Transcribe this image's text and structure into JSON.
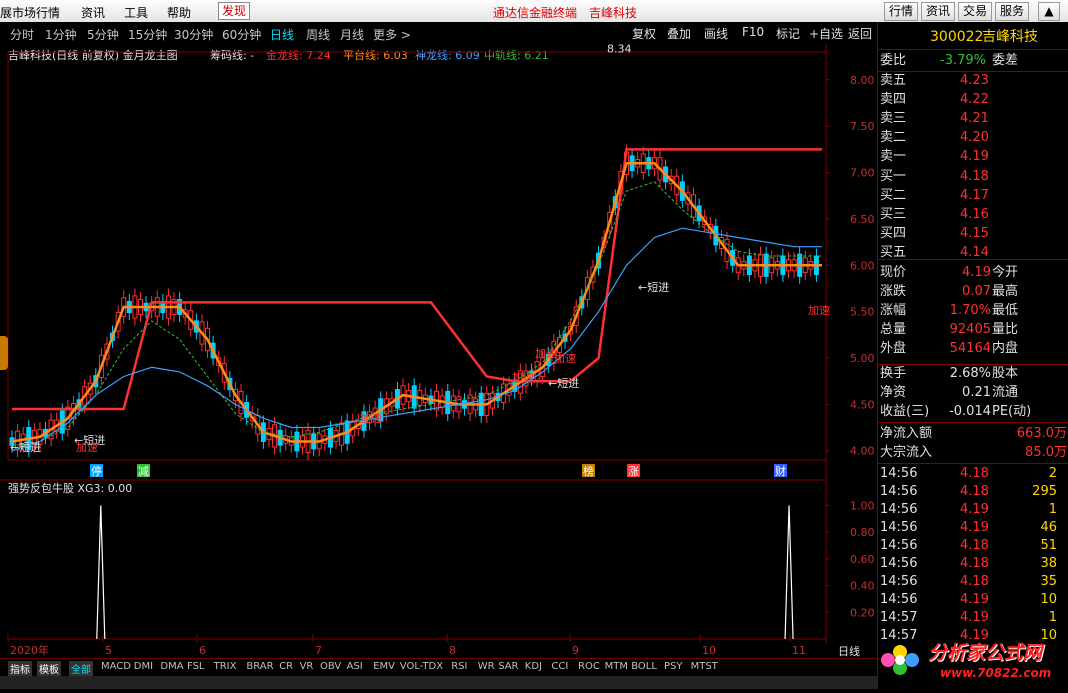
{
  "menubar": {
    "items": [
      "展市场行情",
      "资讯",
      "工具",
      "帮助"
    ],
    "discover": "发现",
    "notice": [
      "通达信金融终端",
      "吉峰科技"
    ],
    "right_buttons": [
      "行情",
      "资讯",
      "交易",
      "服务"
    ]
  },
  "toolbar": {
    "timeframes": [
      "分时",
      "1分钟",
      "5分钟",
      "15分钟",
      "30分钟",
      "60分钟",
      "日线",
      "周线",
      "月线",
      "更多 >"
    ],
    "active": "日线",
    "buttons": [
      "复权",
      "叠加",
      "画线",
      "F10",
      "标记",
      "+自选",
      "返回"
    ]
  },
  "info": {
    "title": "吉峰科技(日线 前复权) 金月龙主图",
    "chip": "筹码线: -",
    "jinlong": "金龙线: 7.24",
    "pingtai": "平台线: 6.03",
    "shenlong": "神龙线: 6.09",
    "zhonggui": "中轨线: 6.21"
  },
  "chart_data": [
    {
      "type": "line",
      "title": "",
      "x": [
        "2020年",
        "5",
        "6",
        "7",
        "8",
        "9",
        "10",
        "11"
      ],
      "ylim": [
        3.9,
        8.3
      ],
      "y_ticks": [
        "8.00",
        "7.50",
        "7.00",
        "6.50",
        "6.00",
        "5.50",
        "5.00",
        "4.50",
        "4.00"
      ],
      "high_label": "8.34",
      "annotations": [
        "短进",
        "短进",
        "加速",
        "加速",
        "加速",
        "加速",
        "加速",
        "短进",
        "短进",
        "加速"
      ],
      "event_markers": [
        "停",
        "减",
        "榜",
        "涨",
        "财"
      ],
      "series": [
        {
          "name": "金龙线",
          "values": [
            4.45,
            4.45,
            4.45,
            4.45,
            4.45,
            5.6,
            5.6,
            5.6,
            5.6,
            5.6,
            5.6,
            5.6,
            5.6,
            5.6,
            5.6,
            5.6,
            5.2,
            4.8,
            4.75,
            4.75,
            4.75,
            5.0,
            7.25,
            7.25,
            7.25,
            7.25,
            7.25,
            7.25,
            7.25,
            7.25
          ]
        },
        {
          "name": "平台线",
          "values": [
            4.1,
            4.15,
            4.35,
            4.75,
            5.55,
            5.55,
            5.55,
            5.2,
            4.6,
            4.2,
            4.1,
            4.1,
            4.2,
            4.4,
            4.6,
            4.55,
            4.5,
            4.5,
            4.7,
            4.9,
            5.3,
            6.05,
            7.1,
            7.1,
            6.8,
            6.4,
            6.0,
            6.0,
            6.0,
            6.0
          ]
        },
        {
          "name": "神龙线",
          "values": [
            4.05,
            4.1,
            4.25,
            4.6,
            5.1,
            5.4,
            5.2,
            4.8,
            4.4,
            4.2,
            4.15,
            4.2,
            4.3,
            4.4,
            4.45,
            4.5,
            4.55,
            4.6,
            4.75,
            4.95,
            5.4,
            6.0,
            6.8,
            6.9,
            6.6,
            6.35,
            6.15,
            6.1,
            6.1,
            6.1
          ]
        },
        {
          "name": "中轨线",
          "values": [
            4.0,
            4.1,
            4.3,
            4.6,
            4.8,
            4.9,
            4.85,
            4.7,
            4.5,
            4.35,
            4.25,
            4.25,
            4.3,
            4.35,
            4.4,
            4.45,
            4.5,
            4.55,
            4.65,
            4.85,
            5.1,
            5.5,
            6.0,
            6.3,
            6.4,
            6.35,
            6.3,
            6.25,
            6.2,
            6.2
          ]
        }
      ]
    },
    {
      "type": "line",
      "title": "强势反包牛股 XG3: 0.00",
      "ylim": [
        0,
        1.1
      ],
      "y_ticks": [
        "1.00",
        "0.80",
        "0.60",
        "0.40",
        "0.20"
      ],
      "series": [
        {
          "name": "XG3",
          "values": [
            0,
            0,
            0,
            1,
            0,
            0,
            0,
            0,
            0,
            0,
            0,
            0,
            0,
            0,
            0,
            0,
            0,
            0,
            0,
            0,
            0,
            0,
            0,
            0,
            0,
            0,
            0,
            0,
            1,
            0
          ]
        }
      ]
    }
  ],
  "quote": {
    "code": "300022",
    "name": "吉峰科技",
    "weibi_label": "委比",
    "weibi_value": "-3.79%",
    "weicha_label": "委差",
    "sell": [
      {
        "label": "卖五",
        "price": "4.23"
      },
      {
        "label": "卖四",
        "price": "4.22"
      },
      {
        "label": "卖三",
        "price": "4.21"
      },
      {
        "label": "卖二",
        "price": "4.20"
      },
      {
        "label": "卖一",
        "price": "4.19"
      }
    ],
    "buy": [
      {
        "label": "买一",
        "price": "4.18"
      },
      {
        "label": "买二",
        "price": "4.17"
      },
      {
        "label": "买三",
        "price": "4.16"
      },
      {
        "label": "买四",
        "price": "4.15"
      },
      {
        "label": "买五",
        "price": "4.14"
      }
    ],
    "stats": [
      {
        "label": "现价",
        "value": "4.19",
        "label2": "今开"
      },
      {
        "label": "涨跌",
        "value": "0.07",
        "label2": "最高"
      },
      {
        "label": "涨幅",
        "value": "1.70%",
        "label2": "最低"
      },
      {
        "label": "总量",
        "value": "92405",
        "label2": "量比"
      },
      {
        "label": "外盘",
        "value": "54164",
        "label2": "内盘"
      }
    ],
    "stats2": [
      {
        "label": "换手",
        "value": "2.68%",
        "label2": "股本"
      },
      {
        "label": "净资",
        "value": "0.21",
        "label2": "流通"
      },
      {
        "label": "收益(三)",
        "value": "-0.014",
        "label2": "PE(动)"
      }
    ],
    "flow": [
      {
        "label": "净流入额",
        "value": "663.0万"
      },
      {
        "label": "大宗流入",
        "value": "85.0万"
      }
    ],
    "ticks": [
      {
        "time": "14:56",
        "price": "4.18",
        "vol": "2"
      },
      {
        "time": "14:56",
        "price": "4.18",
        "vol": "295"
      },
      {
        "time": "14:56",
        "price": "4.19",
        "vol": "1"
      },
      {
        "time": "14:56",
        "price": "4.19",
        "vol": "46"
      },
      {
        "time": "14:56",
        "price": "4.18",
        "vol": "51"
      },
      {
        "time": "14:56",
        "price": "4.18",
        "vol": "38"
      },
      {
        "time": "14:56",
        "price": "4.18",
        "vol": "35"
      },
      {
        "time": "14:56",
        "price": "4.19",
        "vol": "10"
      },
      {
        "time": "14:57",
        "price": "4.19",
        "vol": "1"
      },
      {
        "time": "14:57",
        "price": "4.19",
        "vol": "10"
      }
    ]
  },
  "bottom": {
    "tabs": [
      "指标",
      "模板",
      "全部"
    ],
    "active_tab": "全部",
    "indicators": [
      "MACD",
      "DMI",
      "DMA",
      "FSL",
      "TRIX",
      "BRAR",
      "CR",
      "VR",
      "OBV",
      "ASI",
      "EMV",
      "VOL-TDX",
      "RSI",
      "WR",
      "SAR",
      "KDJ",
      "CCI",
      "ROC",
      "MTM",
      "BOLL",
      "PSY",
      "MTST"
    ],
    "period_label": "日线"
  },
  "watermark": {
    "text1": "分析家公式网",
    "text2": "www.70822.com"
  },
  "colors": {
    "red": "#ff3030",
    "orange": "#ff8c1a",
    "green": "#30c030",
    "blue": "#3aa0ff",
    "yellow": "#ffd700",
    "cyan": "#00e0ff",
    "axis": "#800000"
  }
}
